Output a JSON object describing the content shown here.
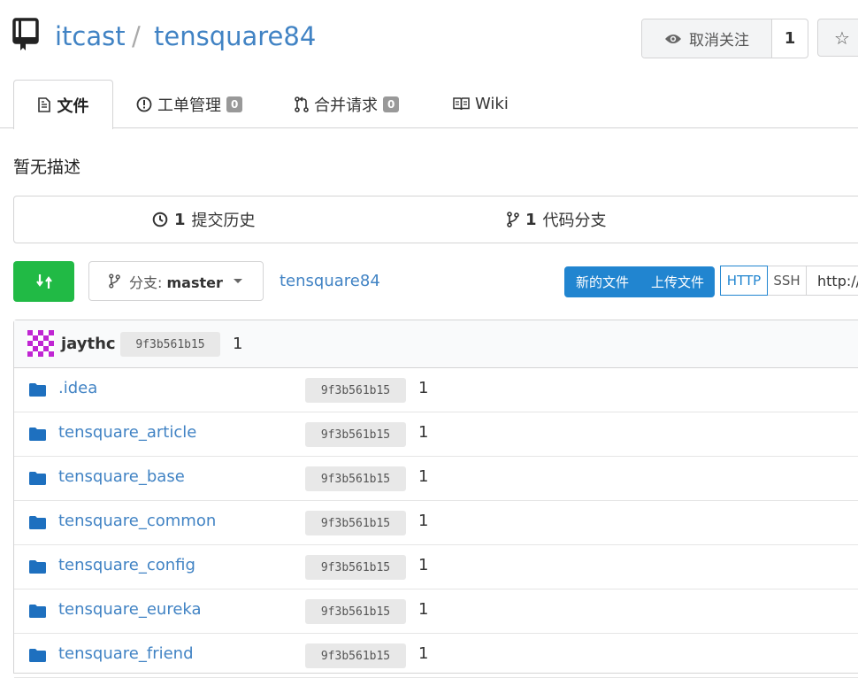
{
  "header": {
    "owner": "itcast",
    "separator": "/",
    "repo": "tensquare84",
    "watch_label": "取消关注",
    "watch_count": "1"
  },
  "tabs": [
    {
      "label": "文件",
      "icon": "file-text-icon"
    },
    {
      "label": "工单管理",
      "badge": "0",
      "icon": "issue-icon"
    },
    {
      "label": "合并请求",
      "badge": "0",
      "icon": "pull-request-icon"
    },
    {
      "label": "Wiki",
      "icon": "book-icon"
    }
  ],
  "description": "暂无描述",
  "stats": {
    "commits_count": "1",
    "commits_label": "提交历史",
    "branches_count": "1",
    "branches_label": "代码分支"
  },
  "toolbar": {
    "branch_prefix": "分支:",
    "branch": "master",
    "breadcrumb": "tensquare84",
    "new_file": "新的文件",
    "upload_file": "上传文件",
    "http": "HTTP",
    "ssh": "SSH",
    "clone_url": "http://"
  },
  "latest_commit": {
    "author": "jaythc",
    "sha": "9f3b561b15",
    "message": "1"
  },
  "files": [
    {
      "name": ".idea",
      "sha": "9f3b561b15",
      "message": "1"
    },
    {
      "name": "tensquare_article",
      "sha": "9f3b561b15",
      "message": "1"
    },
    {
      "name": "tensquare_base",
      "sha": "9f3b561b15",
      "message": "1"
    },
    {
      "name": "tensquare_common",
      "sha": "9f3b561b15",
      "message": "1"
    },
    {
      "name": "tensquare_config",
      "sha": "9f3b561b15",
      "message": "1"
    },
    {
      "name": "tensquare_eureka",
      "sha": "9f3b561b15",
      "message": "1"
    },
    {
      "name": "tensquare_friend",
      "sha": "9f3b561b15",
      "message": "1"
    }
  ],
  "colors": {
    "link": "#4183c4",
    "primary": "#2185d0",
    "success": "#21ba45",
    "avatar": "#c026d3"
  }
}
